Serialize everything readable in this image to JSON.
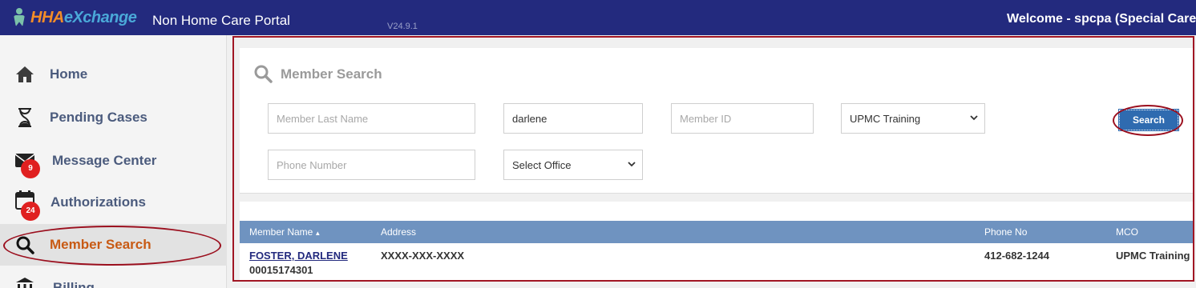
{
  "header": {
    "logo_hha": "HHA",
    "logo_exchange": "eXchange",
    "portal_title": "Non Home Care Portal",
    "version": "V24.9.1",
    "welcome": "Welcome - spcpa (Special Care I"
  },
  "sidebar": {
    "items": [
      {
        "label": "Home",
        "icon": "home-icon"
      },
      {
        "label": "Pending Cases",
        "icon": "hourglass-icon"
      },
      {
        "label": "Message Center",
        "icon": "envelope-icon",
        "badge": "9"
      },
      {
        "label": "Authorizations",
        "icon": "calendar-icon",
        "badge": "24"
      },
      {
        "label": "Member Search",
        "icon": "search-icon",
        "active": true
      },
      {
        "label": "Billing",
        "icon": "bank-icon"
      }
    ]
  },
  "search": {
    "title": "Member Search",
    "last_name_placeholder": "Member Last Name",
    "first_name_value": "darlene",
    "member_id_placeholder": "Member ID",
    "mco_value": "UPMC Training",
    "phone_placeholder": "Phone Number",
    "office_value": "Select Office",
    "button_label": "Search"
  },
  "results": {
    "columns": [
      "Member Name",
      "Address",
      "Phone No",
      "MCO"
    ],
    "sort_indicator": "▲",
    "rows": [
      {
        "name": "FOSTER, DARLENE",
        "member_id": "00015174301",
        "address": "XXXX-XXX-XXXX",
        "phone": "412-682-1244",
        "mco": "UPMC Training"
      }
    ]
  },
  "colors": {
    "topbar": "#232a7e",
    "active_nav": "#c85a14",
    "table_header": "#6f93c0",
    "search_button": "#2f6bb0",
    "highlight_frame": "#a11624"
  }
}
